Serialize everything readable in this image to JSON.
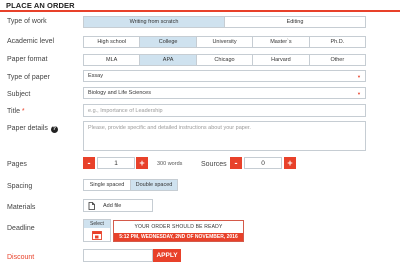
{
  "page_title": "PLACE AN ORDER",
  "labels": {
    "type_of_work": "Type of work",
    "academic_level": "Academic level",
    "paper_format": "Paper format",
    "type_of_paper": "Type of paper",
    "subject": "Subject",
    "title": "Title",
    "paper_details": "Paper details",
    "pages": "Pages",
    "sources": "Sources",
    "spacing": "Spacing",
    "materials": "Materials",
    "deadline": "Deadline",
    "discount": "Discount",
    "required_mark": "*",
    "help_glyph": "?"
  },
  "type_of_work": {
    "options": [
      "Writing from scratch",
      "Editing"
    ],
    "selected": 0
  },
  "academic_level": {
    "options": [
      "High school",
      "College",
      "University",
      "Master`s",
      "Ph.D."
    ],
    "selected": 1
  },
  "paper_format": {
    "options": [
      "MLA",
      "APA",
      "Chicago",
      "Harvard",
      "Other"
    ],
    "selected": 1
  },
  "type_of_paper": {
    "value": "Essay"
  },
  "subject": {
    "value": "Biology and Life Sciences"
  },
  "title_field": {
    "placeholder": "e.g., Importance of Leadership"
  },
  "paper_details": {
    "placeholder": "Please, provide specific and detailed instructions about your paper."
  },
  "pages": {
    "minus": "-",
    "value": "1",
    "plus": "+",
    "words": "300 words"
  },
  "sources": {
    "minus": "-",
    "value": "0",
    "plus": "+"
  },
  "spacing": {
    "options": [
      "Single spaced",
      "Double spaced"
    ],
    "selected": 1
  },
  "materials": {
    "button": "Add file"
  },
  "deadline": {
    "select_label": "Select",
    "ready_title": "YOUR ORDER SHOULD BE READY",
    "ready_time": "5:12 PM, WEDNESDAY, 2ND OF NOVEMBER, 2016"
  },
  "discount": {
    "apply": "APPLY"
  },
  "colors": {
    "accent": "#e8412a",
    "selected": "#cfe2ef",
    "border": "#c6cdd3"
  }
}
